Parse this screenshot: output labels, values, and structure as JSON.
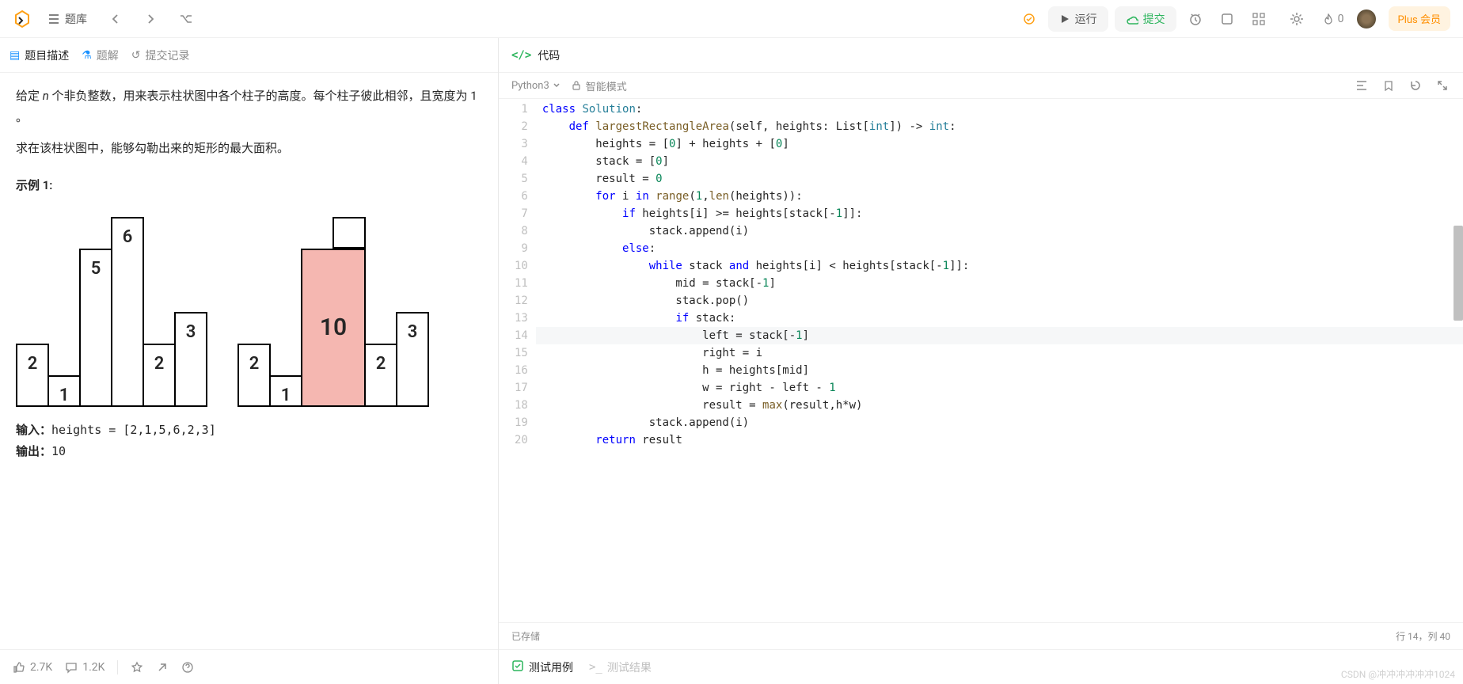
{
  "topbar": {
    "problem_list": "题库",
    "run": "运行",
    "submit": "提交",
    "flame_count": "0",
    "plus": "Plus 会员"
  },
  "tabs": {
    "description": "题目描述",
    "solution": "题解",
    "submissions": "提交记录"
  },
  "problem": {
    "p1_part1": "给定 ",
    "p1_var": "n",
    "p1_part2": " 个非负整数，用来表示柱状图中各个柱子的高度。每个柱子彼此相邻，且宽度为 1 。",
    "p2": "求在该柱状图中，能够勾勒出来的矩形的最大面积。",
    "example_label": "示例 1:",
    "input_label": "输入：",
    "input_code": "heights = [2,1,5,6,2,3]",
    "output_label": "输出：",
    "output_value": "10"
  },
  "chart_data": [
    {
      "type": "bar",
      "categories": [
        "0",
        "1",
        "2",
        "3",
        "4",
        "5"
      ],
      "values": [
        2,
        1,
        5,
        6,
        2,
        3
      ],
      "labels": [
        "2",
        "1",
        "5",
        "6",
        "2",
        "3"
      ],
      "title": "histogram input",
      "xlabel": "",
      "ylabel": "",
      "ylim": [
        0,
        6
      ]
    },
    {
      "type": "bar",
      "categories": [
        "0",
        "1",
        "2",
        "3",
        "4",
        "5"
      ],
      "values": [
        2,
        1,
        5,
        6,
        2,
        3
      ],
      "labels": [
        "2",
        "1",
        "",
        "10",
        "2",
        "3"
      ],
      "highlight_indices": [
        2,
        3
      ],
      "highlight_area": 10,
      "title": "histogram with max rectangle",
      "xlabel": "",
      "ylabel": "",
      "ylim": [
        0,
        6
      ]
    }
  ],
  "footer": {
    "likes": "2.7K",
    "comments": "1.2K"
  },
  "code_panel": {
    "title": "代码",
    "language": "Python3",
    "smart_mode": "智能模式",
    "saved": "已存储",
    "cursor": "行 14，列 40"
  },
  "code": {
    "lines": [
      {
        "n": 1,
        "html": "<span class='kw'>class</span> <span class='cls'>Solution</span>:"
      },
      {
        "n": 2,
        "html": "    <span class='kw'>def</span> <span class='fn'>largestRectangleArea</span>(<span>self</span>, heights: List[<span class='cls'>int</span>]) -> <span class='cls'>int</span>:"
      },
      {
        "n": 3,
        "html": "        heights = [<span class='num'>0</span>] + heights + [<span class='num'>0</span>]"
      },
      {
        "n": 4,
        "html": "        stack = [<span class='num'>0</span>]"
      },
      {
        "n": 5,
        "html": "        result = <span class='num'>0</span>"
      },
      {
        "n": 6,
        "html": "        <span class='kw'>for</span> i <span class='kw'>in</span> <span class='fn'>range</span>(<span class='num'>1</span>,<span class='fn'>len</span>(heights)):"
      },
      {
        "n": 7,
        "html": "            <span class='kw'>if</span> heights[i] &gt;= heights[stack[-<span class='num'>1</span>]]:"
      },
      {
        "n": 8,
        "html": "                stack.append(i)"
      },
      {
        "n": 9,
        "html": "            <span class='kw'>else</span>:"
      },
      {
        "n": 10,
        "html": "                <span class='kw'>while</span> stack <span class='kw'>and</span> heights[i] &lt; heights[stack[-<span class='num'>1</span>]]:"
      },
      {
        "n": 11,
        "html": "                    mid = stack[-<span class='num'>1</span>]"
      },
      {
        "n": 12,
        "html": "                    stack.pop()"
      },
      {
        "n": 13,
        "html": "                    <span class='kw'>if</span> stack:"
      },
      {
        "n": 14,
        "html": "                        left = stack[-<span class='num'>1</span>]",
        "active": true
      },
      {
        "n": 15,
        "html": "                        right = i"
      },
      {
        "n": 16,
        "html": "                        h = heights[mid]"
      },
      {
        "n": 17,
        "html": "                        w = right - left - <span class='num'>1</span>"
      },
      {
        "n": 18,
        "html": "                        result = <span class='fn'>max</span>(result,h*w)"
      },
      {
        "n": 19,
        "html": "                stack.append(i)"
      },
      {
        "n": 20,
        "html": "        <span class='kw'>return</span> result"
      }
    ]
  },
  "bottom_tabs": {
    "testcase": "测试用例",
    "result": "测试结果"
  },
  "watermark": "CSDN @冲冲冲冲冲冲1024"
}
